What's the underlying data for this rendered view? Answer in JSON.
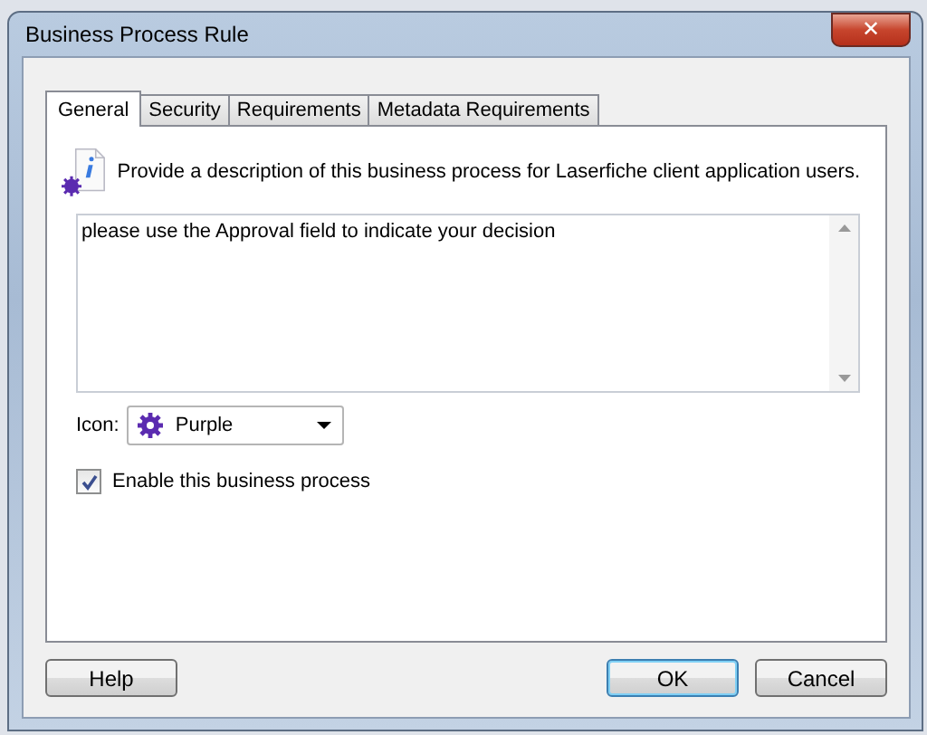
{
  "window": {
    "title": "Business Process Rule",
    "close": "✕"
  },
  "tabs": [
    {
      "label": "General",
      "selected": true
    },
    {
      "label": "Security",
      "selected": false
    },
    {
      "label": "Requirements",
      "selected": false
    },
    {
      "label": "Metadata Requirements",
      "selected": false
    }
  ],
  "description_prompt": "Provide a description of this business process for Laserfiche client application users.",
  "description": "please use the Approval field to indicate your decision",
  "icon": {
    "label": "Icon:",
    "value": "Purple"
  },
  "enable": {
    "label": "Enable this business process",
    "checked": true
  },
  "buttons": [
    {
      "label": "Help",
      "default": false
    },
    {
      "label": "OK",
      "default": true
    },
    {
      "label": "Cancel",
      "default": false
    }
  ]
}
